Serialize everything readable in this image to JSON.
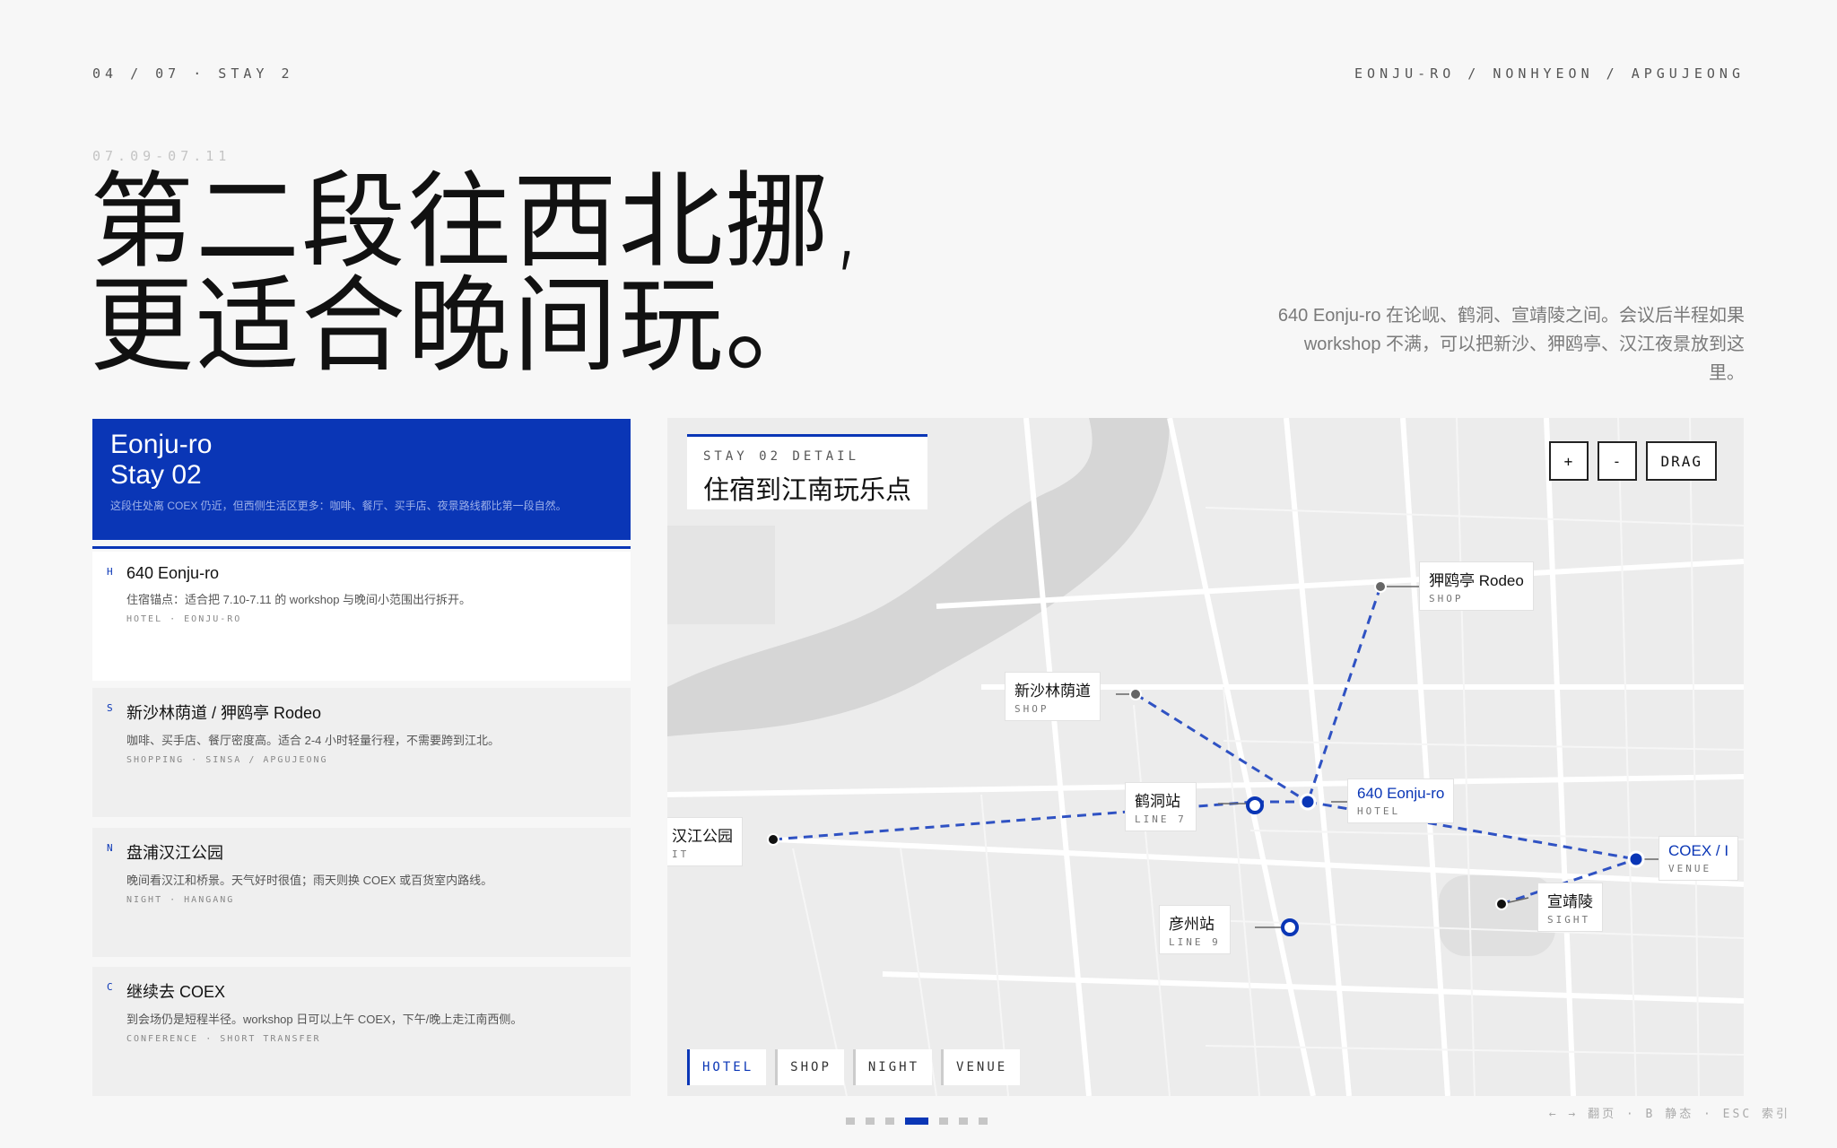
{
  "header": {
    "progress": "04 / 07 · STAY 2",
    "route": "EONJU-RO / NONHYEON / APGUJEONG",
    "dates": "07.09-07.11",
    "headline": [
      "第二段往西北挪,",
      "更适合晚间玩。"
    ],
    "intro": "640 Eonju-ro 在论岘、鹤洞、宣靖陵之间。会议后半程如果 workshop 不满，可以把新沙、狎鸥亭、汉江夜景放到这里。"
  },
  "panel": {
    "title_line1": "Eonju-ro",
    "title_line2": "Stay 02",
    "description": "这段住处离 COEX 仍近，但西侧生活区更多：咖啡、餐厅、买手店、夜景路线都比第一段自然。"
  },
  "stays": [
    {
      "letter": "H",
      "name": "640 Eonju-ro",
      "sub": "住宿锚点：适合把 7.10-7.11 的 workshop 与晚间小范围出行拆开。",
      "tag": "HOTEL · EONJU-RO"
    },
    {
      "letter": "S",
      "name": "新沙林荫道 / 狎鸥亭 Rodeo",
      "sub": "咖啡、买手店、餐厅密度高。适合 2-4 小时轻量行程，不需要跨到江北。",
      "tag": "SHOPPING · SINSA / APGUJEONG"
    },
    {
      "letter": "N",
      "name": "盘浦汉江公园",
      "sub": "晚间看汉江和桥景。天气好时很值；雨天则换 COEX 或百货室内路线。",
      "tag": "NIGHT · HANGANG"
    },
    {
      "letter": "C",
      "name": "继续去 COEX",
      "sub": "到会场仍是短程半径。workshop 日可以上午 COEX，下午/晚上走江南西侧。",
      "tag": "CONFERENCE · SHORT TRANSFER"
    }
  ],
  "map": {
    "detail_label": "STAY 02 DETAIL",
    "detail_title": "住宿到江南玩乐点",
    "controls": {
      "zoom_in": "+",
      "zoom_out": "-",
      "drag": "DRAG"
    },
    "pins": {
      "apgujeong": {
        "name": "狎鸥亭 Rodeo",
        "cat": "SHOP"
      },
      "sinsa": {
        "name": "新沙林荫道",
        "cat": "SHOP"
      },
      "hakdong": {
        "name": "鹤洞站",
        "cat": "LINE 7"
      },
      "hotel": {
        "name": "640 Eonju-ro",
        "cat": "HOTEL"
      },
      "banpo": {
        "name": "汉江公园",
        "cat": "IT"
      },
      "coex": {
        "name": "COEX / I",
        "cat": "VENUE"
      },
      "seonjeong": {
        "name": "宣靖陵",
        "cat": "SIGHT"
      },
      "eonju": {
        "name": "彦州站",
        "cat": "LINE 9"
      }
    },
    "filters": [
      "HOTEL",
      "SHOP",
      "NIGHT",
      "VENUE"
    ],
    "accent": "#0a36b6"
  },
  "footer": {
    "keys": "← → 翻页 · B 静态 · ESC 索引"
  }
}
